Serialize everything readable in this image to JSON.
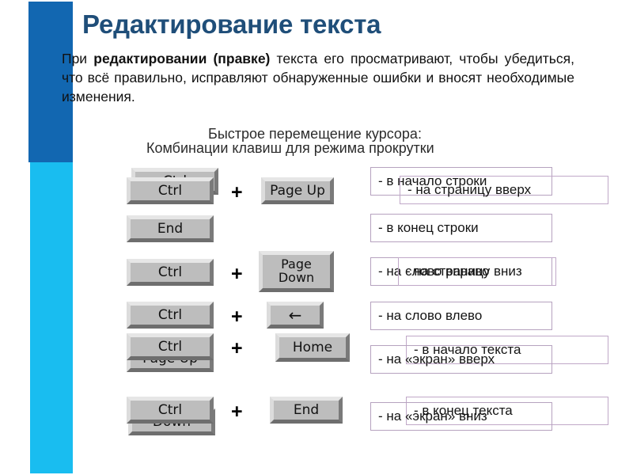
{
  "slide": {
    "title": "Редактирование текста",
    "intro_lead": "При ",
    "intro_bold": "редактировании (правке)",
    "intro_rest": " текста его просматривают, чтобы убедиться, что всё правильно, исправляют обнаруженные ошибки и вносят необходимые изменения.",
    "subtitle_cursor": "Быстрое перемещение курсора:",
    "subtitle_scroll": "Комбинации клавиш для режима прокрутки"
  },
  "colors": {
    "title": "#1f4e79",
    "bar_dark": "#1267b1",
    "bar_cyan": "#19bdf0",
    "key_face": "#bdbdbd",
    "desc_border": "#b6a2bf"
  },
  "plus_signs": [
    {
      "label": "+"
    },
    {
      "label": "+"
    },
    {
      "label": "+"
    },
    {
      "label": "+"
    },
    {
      "label": "+"
    },
    {
      "label": "+"
    }
  ],
  "keys": {
    "ctrl_r1_back": "Ctrl",
    "ctrl_r1_front": "Ctrl",
    "page_up_r1": "Page Up",
    "end_r2": "End",
    "ctrl_r3": "Ctrl",
    "page_down_r3": "Page\nDown",
    "page_down_r3_line1": "Page",
    "page_down_r3_line2": "Down",
    "ctrl_r4": "Ctrl",
    "arrow_left_r4": "←",
    "ctrl_r5_front": "Ctrl",
    "page_up_r5_back": "Page Up",
    "home_r5": "Home",
    "ctrl_r6_front": "Ctrl",
    "down_r6_back": "Down",
    "end_r6": "End"
  },
  "descriptions": {
    "line_start": "- в начало строки",
    "page_up": "- на страницу вверх",
    "line_end": "- в конец строки",
    "word_right": "- на слово вправо",
    "page_down": "- на страницу вниз",
    "word_left": "- на слово влево",
    "text_start": "-  в  начало текста",
    "screen_up": "- на «экран» вверх",
    "text_end": "- в конец текста",
    "screen_down": "- на «экран» вниз"
  }
}
